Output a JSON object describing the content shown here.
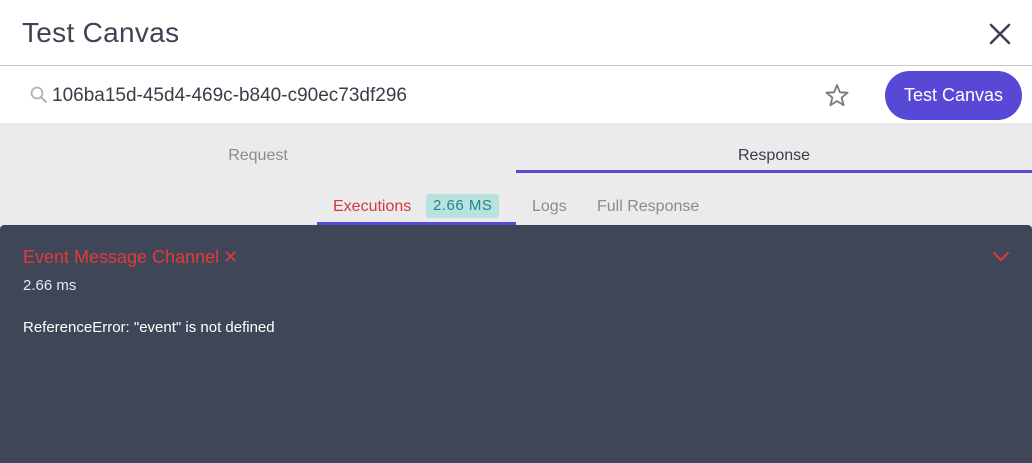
{
  "header": {
    "title": "Test Canvas"
  },
  "search": {
    "canvas_id": "106ba15d-45d4-469c-b840-c90ec73df296",
    "button_label": "Test Canvas"
  },
  "tabs": {
    "request": "Request",
    "response": "Response"
  },
  "subtabs": {
    "executions": "Executions",
    "executions_badge": "2.66 MS",
    "logs": "Logs",
    "full_response": "Full Response"
  },
  "execution": {
    "name": "Event Message Channel",
    "status_icon": "✕",
    "duration": "2.66 ms",
    "error": "ReferenceError: \"event\" is not defined"
  },
  "colors": {
    "accent": "#5848d6",
    "error": "#e23a3a",
    "panel": "#3f4657",
    "badge_bg": "#b8e1df",
    "badge_text": "#1e8b84"
  }
}
